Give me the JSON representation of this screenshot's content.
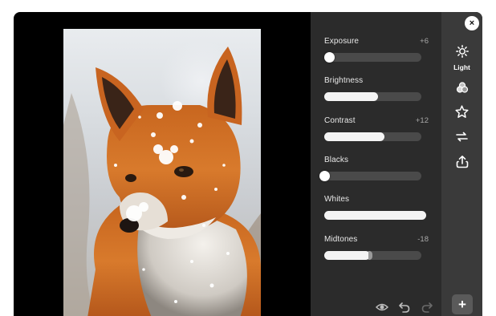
{
  "adjustments": [
    {
      "label": "Exposure",
      "value": "+6",
      "level": 0.05,
      "type": "knob"
    },
    {
      "label": "Brightness",
      "value": "",
      "level": 0.55,
      "type": "fill"
    },
    {
      "label": "Contrast",
      "value": "+12",
      "level": 0.62,
      "type": "fill"
    },
    {
      "label": "Blacks",
      "value": "",
      "level": 0.0,
      "type": "knob"
    },
    {
      "label": "Whites",
      "value": "",
      "level": 1.0,
      "type": "fill"
    },
    {
      "label": "Midtones",
      "value": "-18",
      "level": 0.47,
      "type": "fill"
    }
  ],
  "rail": {
    "active_label": "Light",
    "items": [
      "sun-icon",
      "color-circles-icon",
      "star-icon",
      "crop-rotate-icon",
      "export-icon"
    ]
  },
  "window": {
    "close_glyph": "×",
    "add_glyph": "+"
  },
  "bottom_tools": [
    "eye-icon",
    "undo-icon",
    "redo-icon"
  ],
  "colors": {
    "panel": "#2b2b2b",
    "rail": "#3a3a3a",
    "track": "#4a4a4a",
    "fill": "#f4f4f4"
  }
}
